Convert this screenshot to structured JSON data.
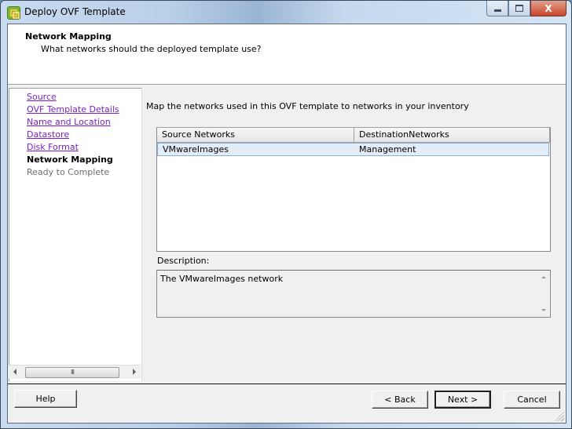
{
  "window": {
    "title": "Deploy OVF Template",
    "icon": "vsphere-app-icon",
    "controls": {
      "minimize": "minimize-icon",
      "maximize": "maximize-icon",
      "close": "close-icon",
      "close_glyph": "X"
    }
  },
  "header": {
    "title": "Network Mapping",
    "subtitle": "What networks should the deployed template use?"
  },
  "steps": [
    {
      "label": "Source",
      "state": "completed"
    },
    {
      "label": "OVF Template Details",
      "state": "completed"
    },
    {
      "label": "Name and Location",
      "state": "completed"
    },
    {
      "label": "Datastore",
      "state": "completed"
    },
    {
      "label": "Disk Format",
      "state": "completed"
    },
    {
      "label": "Network Mapping",
      "state": "current"
    },
    {
      "label": "Ready to Complete",
      "state": "pending"
    }
  ],
  "steps_scrollbar": {
    "thumb_glyph": "III"
  },
  "main": {
    "intro": "Map the networks used in this OVF template to networks in your inventory",
    "table": {
      "columns": [
        "Source Networks",
        "DestinationNetworks"
      ],
      "rows": [
        {
          "source": "VMwareImages",
          "destination": "Management",
          "selected": true
        }
      ]
    },
    "description_label": "Description:",
    "description_text": "The VMwareImages network"
  },
  "buttons": {
    "help": "Help",
    "back": "< Back",
    "next": "Next >",
    "cancel": "Cancel"
  },
  "colors": {
    "link": "#7a1fc8",
    "selection": "#e3edf8",
    "selection_border": "#8ab0d8",
    "dialog_bg": "#f0f0f0"
  }
}
